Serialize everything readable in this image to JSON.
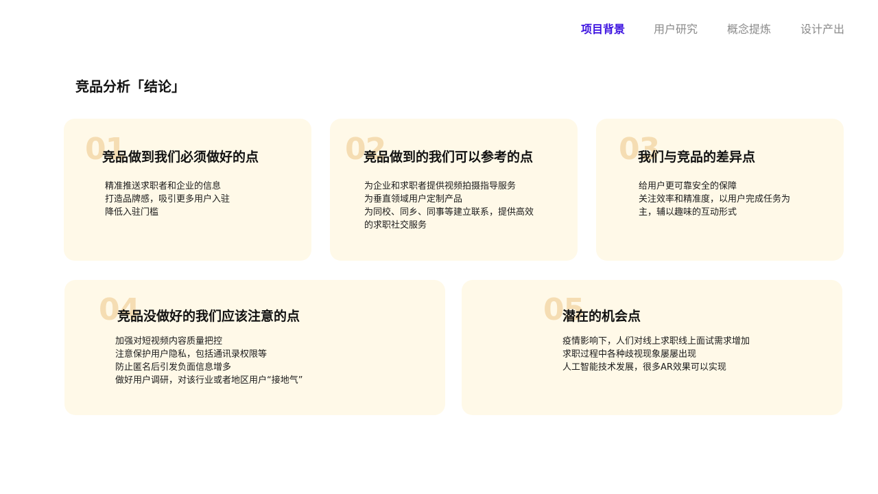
{
  "nav": {
    "items": [
      {
        "label": "项目背景",
        "active": true
      },
      {
        "label": "用户研究",
        "active": false
      },
      {
        "label": "概念提炼",
        "active": false
      },
      {
        "label": "设计产出",
        "active": false
      }
    ]
  },
  "section": {
    "title": "竞品分析「结论」"
  },
  "cards": [
    {
      "number": "01",
      "title": "竞品做到我们必须做好的点",
      "points": [
        "精准推送求职者和企业的信息",
        "打造品牌感，吸引更多用户入驻",
        "降低入驻门槛"
      ]
    },
    {
      "number": "02",
      "title": "竞品做到的我们可以参考的点",
      "points": [
        "为企业和求职者提供视频拍摄指导服务",
        "为垂直领域用户定制产品",
        "为同校、同乡、同事等建立联系，提供高效",
        "的求职社交服务"
      ]
    },
    {
      "number": "03",
      "title": "我们与竞品的差异点",
      "points": [
        "给用户更可靠安全的保障",
        "关注效率和精准度，以用户完成任务为",
        "主，辅以趣味的互动形式"
      ]
    },
    {
      "number": "04",
      "title": "竞品没做好的我们应该注意的点",
      "points": [
        "加强对短视频内容质量把控",
        "注意保护用户隐私，包括通讯录权限等",
        "防止匿名后引发负面信息增多",
        "做好用户调研，对该行业或者地区用户“接地气”"
      ]
    },
    {
      "number": "05",
      "title": "潜在的机会点",
      "points": [
        "疫情影响下，人们对线上求职线上面试需求增加",
        "求职过程中各种歧视现象屡屡出现",
        "人工智能技术发展，很多AR效果可以实现"
      ]
    }
  ],
  "colors": {
    "accent": "#3a10e0",
    "nav_inactive": "#8a8a8a",
    "card_bg": "#fff9e8",
    "card_number": "#f5ddb3"
  }
}
